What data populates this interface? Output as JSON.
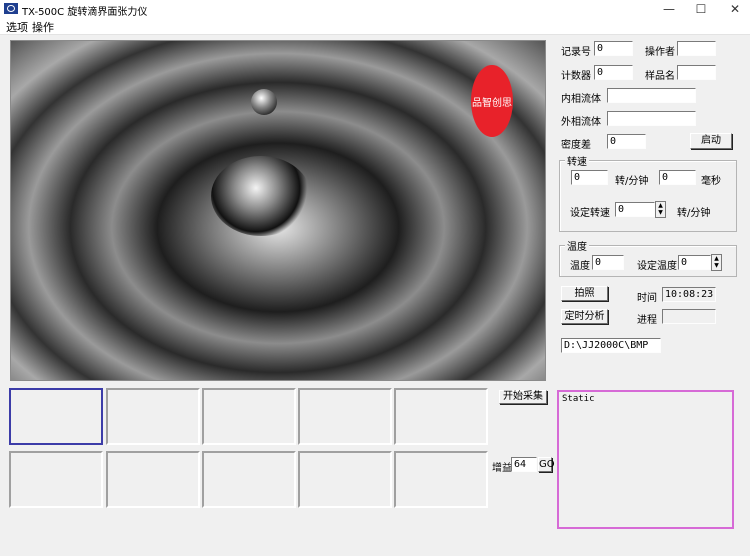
{
  "window": {
    "title": "TX-500C 旋转滴界面张力仪",
    "minimize": "—",
    "maximize": "☐",
    "close": "✕"
  },
  "menu": [
    "选项",
    "操作"
  ],
  "photo": {
    "stamp_text": "品智创思"
  },
  "capture": {
    "start_button": "开始采集",
    "gain_label": "增益",
    "gain_value": "64",
    "go_button": "GO"
  },
  "form": {
    "record_label": "记录号",
    "record_value": "0",
    "operator_label": "操作者",
    "operator_value": "",
    "counter_label": "计数器",
    "counter_value": "0",
    "sample_label": "样品名",
    "sample_value": "",
    "inner_fluid_label": "内相流体",
    "inner_fluid_value": "",
    "outer_fluid_label": "外相流体",
    "outer_fluid_value": "",
    "density_label": "密度差",
    "density_value": "0",
    "start_button": "启动"
  },
  "speed": {
    "title": "转速",
    "rpm_value": "0",
    "rpm_unit": "转/分钟",
    "ms_value": "0",
    "ms_unit": "毫秒",
    "set_label": "设定转速",
    "set_value": "0",
    "set_unit": "转/分钟"
  },
  "temperature": {
    "title": "温度",
    "temp_label": "温度",
    "temp_value": "0",
    "set_label": "设定温度",
    "set_value": "0"
  },
  "actions": {
    "photo_button": "拍照",
    "time_label": "时间",
    "time_value": "10:08:23",
    "timed_button": "定时分析",
    "progress_label": "进程",
    "progress_value": "",
    "path_value": "D:\\JJ2000C\\BMP"
  },
  "static_text": "Static",
  "colors": {
    "stamp": "#e8222a",
    "static_border": "#d66ad6",
    "selected_thumb": "#3c3ca8"
  }
}
